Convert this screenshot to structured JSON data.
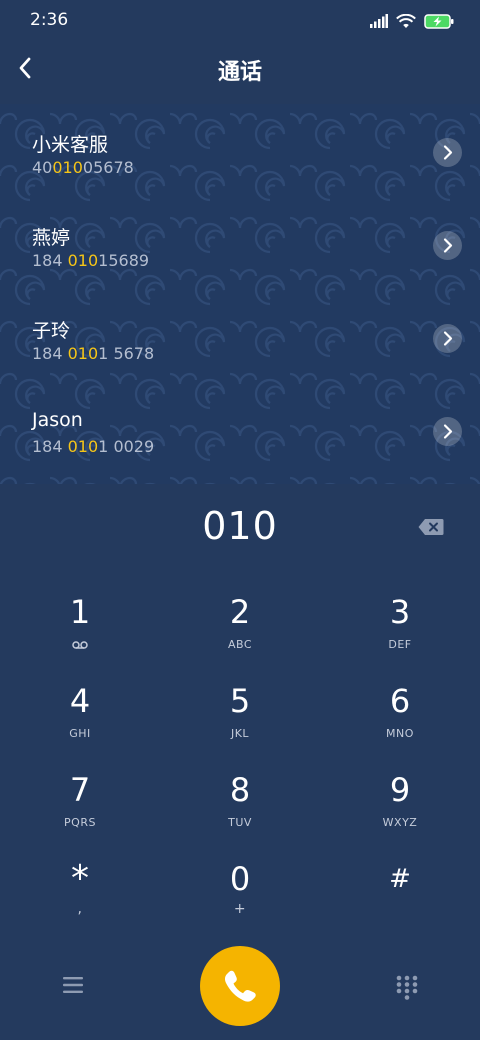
{
  "status": {
    "time": "2:36",
    "icons": [
      "signal-icon",
      "wifi-icon",
      "battery-charging-icon"
    ],
    "battery_color": "#4cd964"
  },
  "header": {
    "title": "通话",
    "back_icon": "back-arrow-icon"
  },
  "contacts": [
    {
      "name": "小米客服",
      "num_pre": "40",
      "num_hl": "010",
      "num_post": "05678"
    },
    {
      "name": "燕婷",
      "num_pre": "184 ",
      "num_hl": "010",
      "num_post": "15689"
    },
    {
      "name": "子玲",
      "num_pre": "184 ",
      "num_hl": "010",
      "num_post": "1 5678"
    },
    {
      "name": "Jason",
      "num_pre": "184 ",
      "num_hl": "010",
      "num_post": "1 0029"
    }
  ],
  "dial": {
    "number": "010"
  },
  "keypad": [
    {
      "digit": "1",
      "letters": "",
      "sub_icon": "voicemail-icon"
    },
    {
      "digit": "2",
      "letters": "ABC"
    },
    {
      "digit": "3",
      "letters": "DEF"
    },
    {
      "digit": "4",
      "letters": "GHI"
    },
    {
      "digit": "5",
      "letters": "JKL"
    },
    {
      "digit": "6",
      "letters": "MNO"
    },
    {
      "digit": "7",
      "letters": "PQRS"
    },
    {
      "digit": "8",
      "letters": "TUV"
    },
    {
      "digit": "9",
      "letters": "WXYZ"
    },
    {
      "digit": "*",
      "letters": ","
    },
    {
      "digit": "0",
      "letters": "+"
    },
    {
      "digit": "#",
      "letters": ""
    }
  ],
  "colors": {
    "background": "#243a5e",
    "highlight": "#f5c518",
    "call_button": "#f5b400"
  }
}
